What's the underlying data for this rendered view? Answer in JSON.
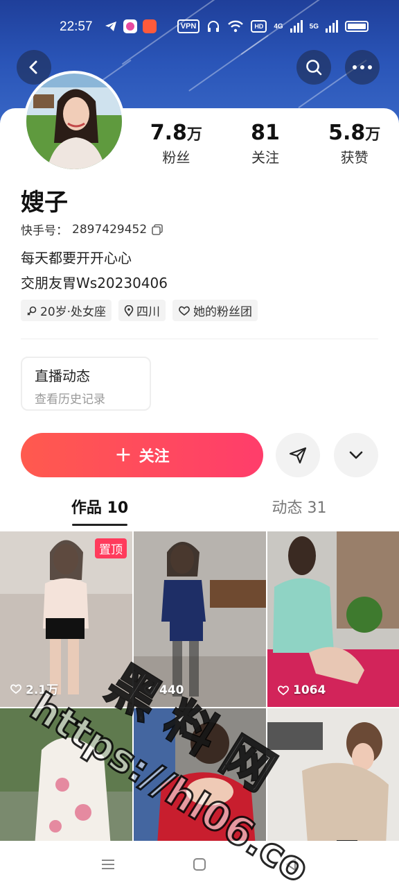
{
  "status_bar": {
    "time": "22:57",
    "vpn": "VPN",
    "hd": "HD",
    "net1": "4G",
    "net2": "5G"
  },
  "nav": {
    "back_icon": "chevron-left-icon",
    "search_icon": "search-icon",
    "more_icon": "more-dots-icon"
  },
  "profile": {
    "stats": [
      {
        "num": "7.8",
        "unit": "万",
        "label": "粉丝"
      },
      {
        "num": "81",
        "unit": "",
        "label": "关注"
      },
      {
        "num": "5.8",
        "unit": "万",
        "label": "获赞"
      }
    ],
    "name": "嫂子",
    "id_label": "快手号：",
    "id_value": "2897429452",
    "bio_line1": "每天都要开开心心",
    "bio_line2": "交朋友胃Ws20230406",
    "tags": [
      "20岁·处女座",
      "四川",
      "她的粉丝团"
    ]
  },
  "live_card": {
    "title": "直播动态",
    "subtitle": "查看历史记录"
  },
  "actions": {
    "follow_label": "关注",
    "plus": "+"
  },
  "tabs": [
    {
      "label": "作品 10",
      "active": true
    },
    {
      "label": "动态 31",
      "active": false
    }
  ],
  "works": [
    {
      "likes": "2.1万",
      "pinned": true,
      "pin_label": "置顶"
    },
    {
      "likes": "440",
      "pinned": false
    },
    {
      "likes": "1064",
      "pinned": false
    },
    {
      "likes": "",
      "pinned": false
    },
    {
      "likes": "",
      "pinned": false
    },
    {
      "likes": "",
      "pinned": false
    }
  ],
  "watermark": {
    "text1": "黑 料 网",
    "text2": "https://hl06.co"
  },
  "colors": {
    "accent": "#ff3d6b",
    "header": "#2a55b8"
  }
}
